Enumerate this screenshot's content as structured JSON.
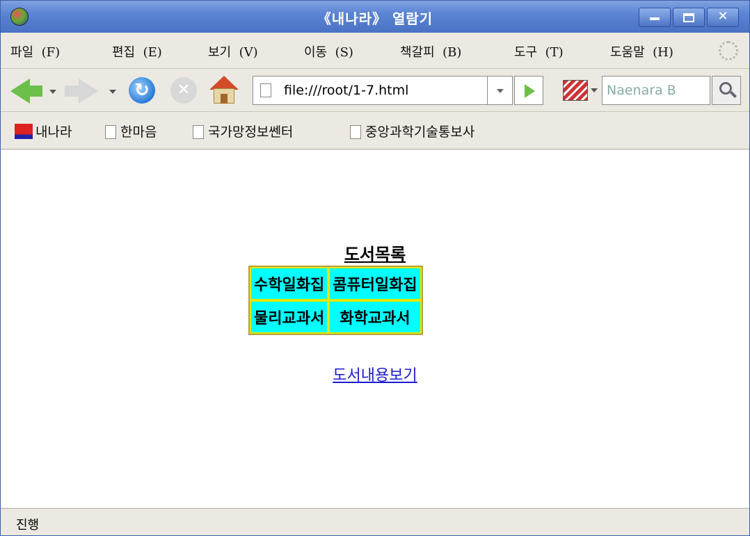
{
  "window": {
    "title": "《내나라》 열람기"
  },
  "menu": {
    "items": [
      {
        "label": "파일",
        "key": "(F)"
      },
      {
        "label": "편집",
        "key": "(E)"
      },
      {
        "label": "보기",
        "key": "(V)"
      },
      {
        "label": "이동",
        "key": "(S)"
      },
      {
        "label": "책갈피",
        "key": "(B)"
      },
      {
        "label": "도구",
        "key": "(T)"
      },
      {
        "label": "도움말",
        "key": "(H)"
      }
    ]
  },
  "navigation": {
    "url": "file:///root/1-7.html",
    "search_placeholder": "Naenara B"
  },
  "bookmarks": {
    "items": [
      {
        "label": "내나라",
        "icon": "naenara-icon"
      },
      {
        "label": "한마음",
        "icon": "page-icon"
      },
      {
        "label": "국가망정보쎈터",
        "icon": "page-icon"
      },
      {
        "label": "중앙과학기술통보사",
        "icon": "page-icon"
      }
    ]
  },
  "content": {
    "heading": "도서목록",
    "table": [
      [
        "수학일화집",
        "콤퓨터일화집"
      ],
      [
        "물리교과서",
        "화학교과서"
      ]
    ],
    "link": "도서내용보기"
  },
  "status": {
    "text": "진행"
  },
  "colors": {
    "cell_background": "#00ffff",
    "cell_border": "#e6e600",
    "link": "#1a1ad0",
    "titlebar": "#5b84d4"
  }
}
